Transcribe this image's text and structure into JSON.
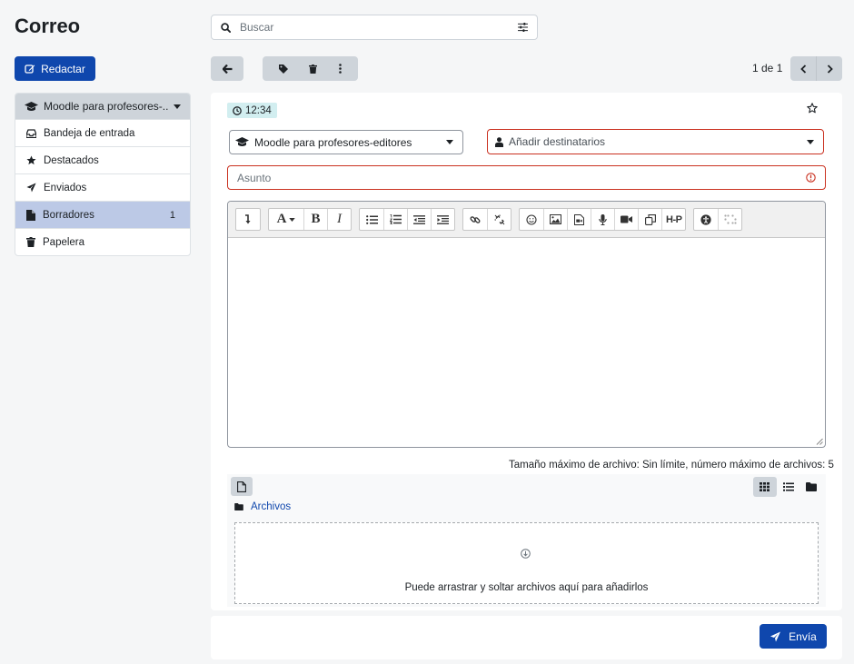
{
  "page": {
    "title": "Correo"
  },
  "compose": {
    "label": "Redactar"
  },
  "search": {
    "placeholder": "Buscar"
  },
  "sidebar": {
    "course": "Moodle para profesores-...",
    "items": [
      {
        "label": "Bandeja de entrada",
        "icon": "inbox-icon"
      },
      {
        "label": "Destacados",
        "icon": "star-icon"
      },
      {
        "label": "Enviados",
        "icon": "paper-plane-icon"
      },
      {
        "label": "Borradores",
        "icon": "file-icon",
        "count": "1",
        "active": true
      },
      {
        "label": "Papelera",
        "icon": "trash-icon"
      }
    ]
  },
  "pager": {
    "text": "1 de 1"
  },
  "message": {
    "time": "12:34",
    "course_select": "Moodle para profesores-editores",
    "recipients_placeholder": "Añadir destinatarios",
    "subject_placeholder": "Asunto"
  },
  "files": {
    "info": "Tamaño máximo de archivo: Sin límite, número máximo de archivos: 5",
    "path": "Archivos",
    "drop_text": "Puede arrastrar y soltar archivos aquí para añadirlos"
  },
  "send": {
    "label": "Envía"
  },
  "colors": {
    "primary": "#0f47ad",
    "danger": "#ca3120",
    "active_item": "#bcc9e6"
  }
}
